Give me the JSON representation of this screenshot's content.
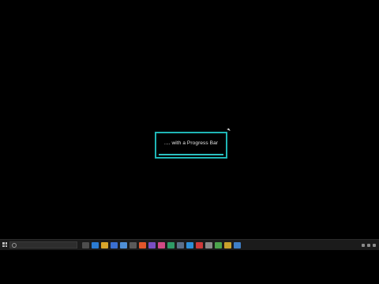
{
  "splash": {
    "message": ".... with a Progress Bar",
    "progress_percent": 100,
    "accent_color": "#1fb5b5"
  },
  "taskbar": {
    "search_placeholder": "",
    "icons": [
      {
        "name": "task-view-icon",
        "color": "#4d4d4d"
      },
      {
        "name": "edge-icon",
        "color": "#2b7bd2"
      },
      {
        "name": "file-explorer-icon",
        "color": "#d8a62c"
      },
      {
        "name": "store-icon",
        "color": "#3b6fd0"
      },
      {
        "name": "mail-icon",
        "color": "#4f8fd6"
      },
      {
        "name": "app-icon-1",
        "color": "#5a5a5a"
      },
      {
        "name": "app-icon-2",
        "color": "#e2562b"
      },
      {
        "name": "app-icon-3",
        "color": "#7a4fc2"
      },
      {
        "name": "app-icon-4",
        "color": "#d24a86"
      },
      {
        "name": "app-icon-5",
        "color": "#2f9a66"
      },
      {
        "name": "app-icon-6",
        "color": "#5c6f88"
      },
      {
        "name": "app-icon-7",
        "color": "#2d8fd8"
      },
      {
        "name": "app-icon-8",
        "color": "#cf3a3a"
      },
      {
        "name": "app-icon-9",
        "color": "#8b8b8b"
      },
      {
        "name": "app-icon-10",
        "color": "#4ca34c"
      },
      {
        "name": "app-icon-11",
        "color": "#caa12b"
      },
      {
        "name": "app-icon-12",
        "color": "#3f7fc7"
      }
    ]
  }
}
